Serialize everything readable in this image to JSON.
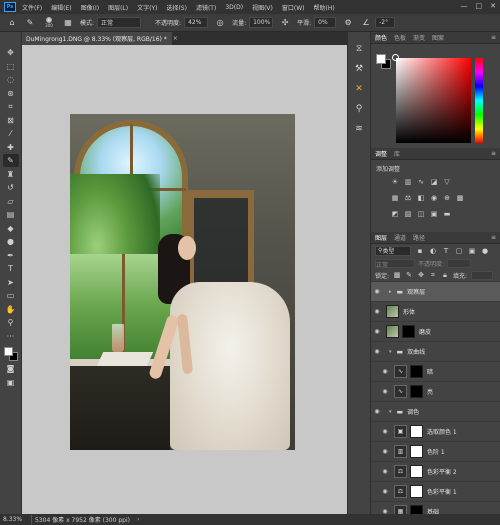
{
  "menu": [
    "文件(F)",
    "编辑(E)",
    "图像(I)",
    "图层(L)",
    "文字(Y)",
    "选择(S)",
    "滤镜(T)",
    "3D(D)",
    "视图(V)",
    "窗口(W)",
    "帮助(H)"
  ],
  "window_controls": {
    "minimize": "—",
    "maximize": "□",
    "close": "✕"
  },
  "options_bar": {
    "brush_size": "300",
    "mode_label": "模式:",
    "mode_value": "正常",
    "opacity_label": "不透明度:",
    "opacity_value": "42%",
    "flow_label": "流量:",
    "flow_value": "100%",
    "smoothing_label": "平滑:",
    "smoothing_value": "0%",
    "angle_value": "-2°"
  },
  "document_tab": {
    "title": "DuMingrong1.DNG @ 8.33% (观察层, RGB/16) *",
    "close": "×"
  },
  "status_bar": {
    "zoom": "8.33%",
    "info": "5304 像素 x 7952 像素 (300 ppi)",
    "arrow": "›"
  },
  "panels": {
    "color_tabs": [
      "颜色",
      "色板",
      "渐变",
      "图案"
    ],
    "adjust_tabs": [
      "调整",
      "库"
    ],
    "adjust_title": "添加调整",
    "layers_tabs": [
      "图层",
      "通道",
      "路径"
    ],
    "filter_kind": "类型",
    "blend_mode": "正常",
    "opacity_label": "不透明度:",
    "lock_label": "锁定:",
    "fill_label": "填充:"
  },
  "layers": [
    {
      "name": "观察层",
      "type": "group",
      "indent": false
    },
    {
      "name": "形体",
      "type": "pixel",
      "indent": false
    },
    {
      "name": "磨皮",
      "type": "pixel-mask",
      "indent": false
    },
    {
      "name": "双曲线",
      "type": "group",
      "indent": false
    },
    {
      "name": "暗",
      "type": "curves",
      "indent": true
    },
    {
      "name": "亮",
      "type": "curves",
      "indent": true
    },
    {
      "name": "调色",
      "type": "group",
      "indent": false
    },
    {
      "name": "选取颜色 1",
      "type": "selective",
      "indent": true
    },
    {
      "name": "色阶 1",
      "type": "levels",
      "indent": true
    },
    {
      "name": "色彩平衡 2",
      "type": "balance",
      "indent": true
    },
    {
      "name": "色彩平衡 1",
      "type": "balance",
      "indent": true
    },
    {
      "name": "基础",
      "type": "pixel-mask",
      "indent": true
    }
  ]
}
